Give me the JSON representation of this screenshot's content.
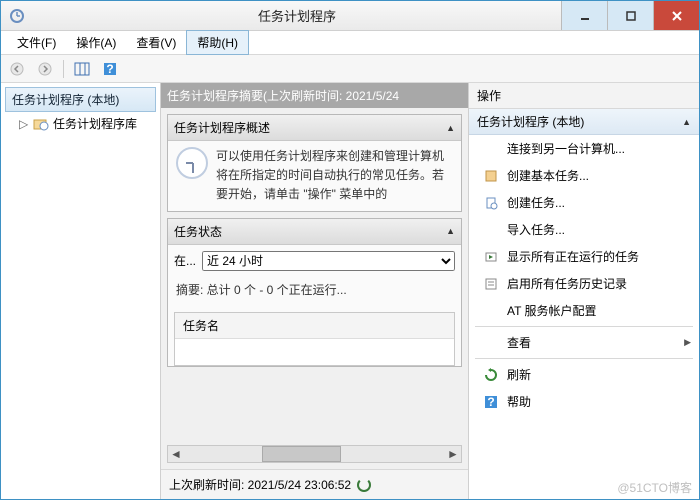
{
  "title": "任务计划程序",
  "menu": {
    "file": "文件(F)",
    "action": "操作(A)",
    "view": "查看(V)",
    "help": "帮助(H)"
  },
  "tree": {
    "header": "任务计划程序 (本地)",
    "item1": "任务计划程序库"
  },
  "center": {
    "header": "任务计划程序摘要(上次刷新时间: 2021/5/24",
    "overview_title": "任务计划程序概述",
    "overview_text": "可以使用任务计划程序来创建和管理计算机将在所指定的时间自动执行的常见任务。若要开始，请单击 \"操作\" 菜单中的",
    "status_title": "任务状态",
    "status_label": "在...",
    "status_selected": "近 24 小时",
    "status_summary": "摘要: 总计 0 个 - 0 个正在运行...",
    "tasklist_header": "任务名",
    "footer": "上次刷新时间: 2021/5/24 23:06:52"
  },
  "actions": {
    "header": "操作",
    "group": "任务计划程序 (本地)",
    "items": {
      "connect": "连接到另一台计算机...",
      "create_basic": "创建基本任务...",
      "create": "创建任务...",
      "import": "导入任务...",
      "show_running": "显示所有正在运行的任务",
      "enable_history": "启用所有任务历史记录",
      "at_service": "AT 服务帐户配置",
      "view": "查看",
      "refresh": "刷新",
      "help": "帮助"
    }
  },
  "watermark": "@51CTO博客"
}
